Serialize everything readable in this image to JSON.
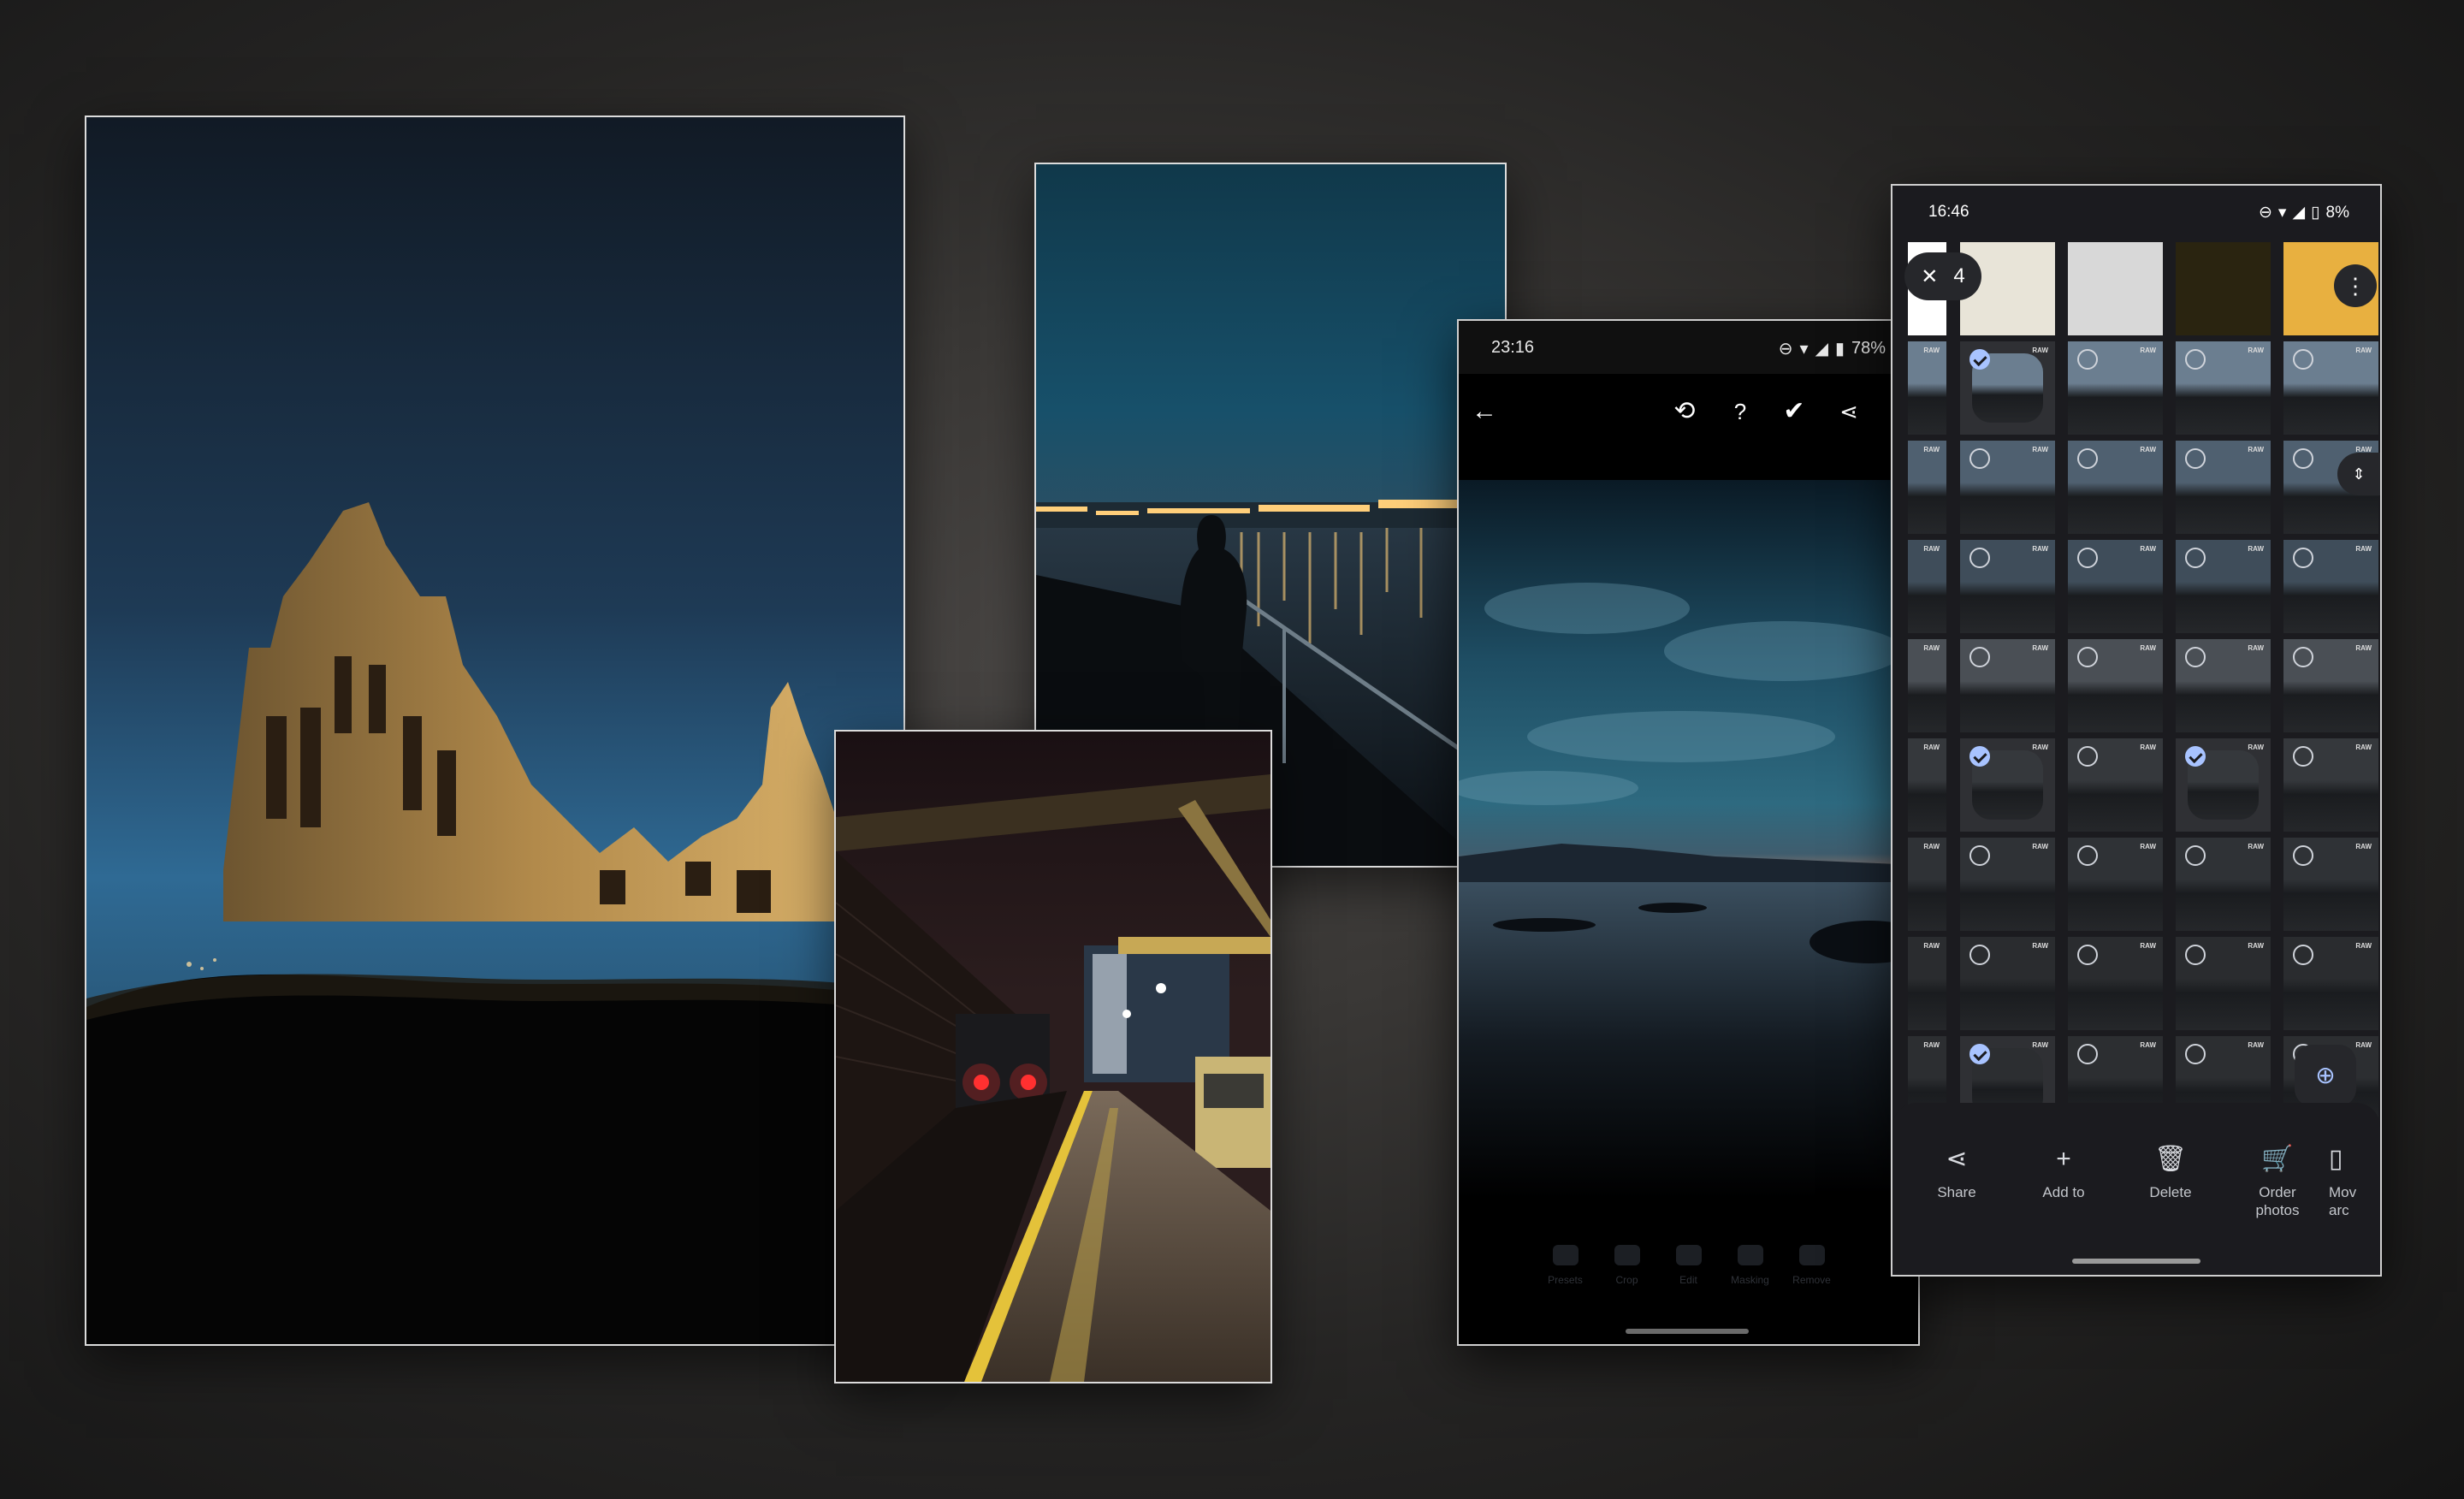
{
  "editor_phone": {
    "status": {
      "time": "23:16",
      "battery": "78%"
    },
    "toolbar": {
      "back_icon": "arrow-left-icon",
      "history_icon": "history-icon",
      "help_icon": "help-circle-icon",
      "done_icon": "check-circle-icon",
      "share_icon": "share-icon",
      "more_icon": "more-vertical-icon"
    },
    "tools": [
      {
        "label": "Presets",
        "icon": "presets-icon"
      },
      {
        "label": "Crop",
        "icon": "crop-icon"
      },
      {
        "label": "Edit",
        "icon": "sliders-icon"
      },
      {
        "label": "Masking",
        "icon": "masking-icon"
      },
      {
        "label": "Remove",
        "icon": "eraser-icon"
      }
    ]
  },
  "gallery_phone": {
    "status": {
      "time": "16:46",
      "battery": "8%"
    },
    "selection": {
      "count": "4",
      "close_icon": "close-icon"
    },
    "raw_label": "RAW",
    "actions": [
      {
        "label": "Share",
        "icon": "share-icon"
      },
      {
        "label": "Add to",
        "icon": "plus-icon"
      },
      {
        "label": "Delete",
        "icon": "trash-icon"
      },
      {
        "label": "Order photos",
        "icon": "cart-icon"
      },
      {
        "label": "Mov arc",
        "icon": "archive-icon"
      }
    ]
  }
}
